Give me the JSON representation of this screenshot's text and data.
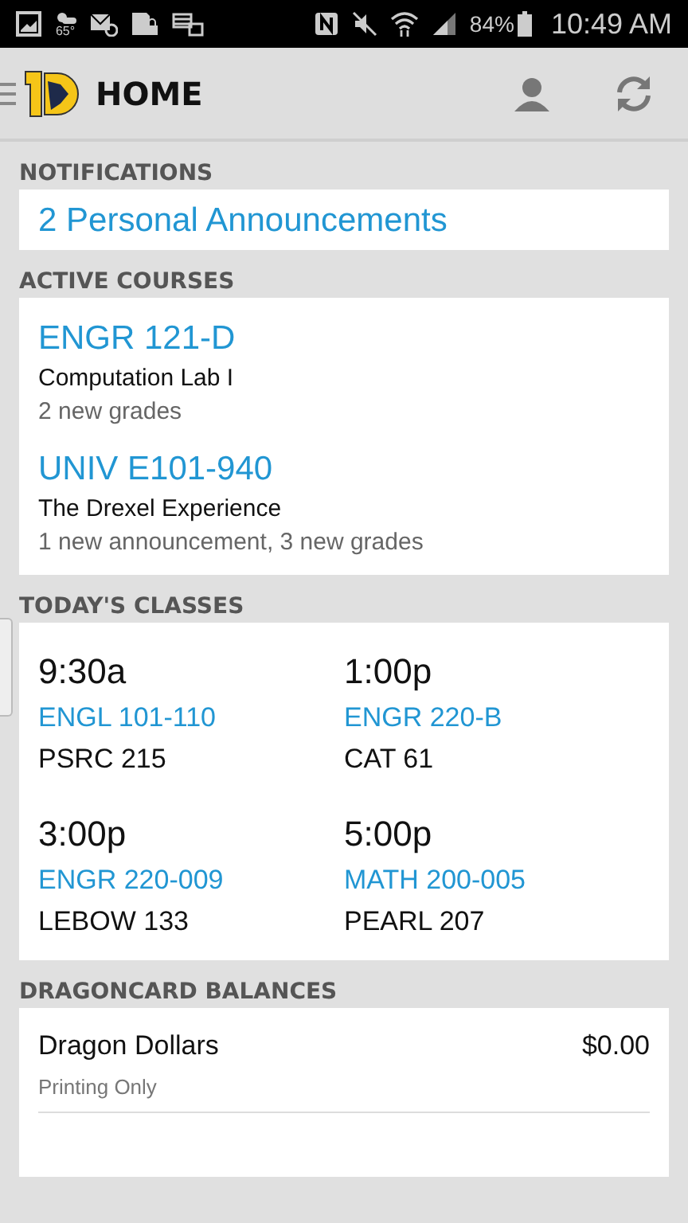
{
  "status_bar": {
    "temperature": "65°",
    "battery": "84%",
    "time": "10:49 AM"
  },
  "header": {
    "title": "HOME"
  },
  "notifications": {
    "heading": "NOTIFICATIONS",
    "link": "2 Personal Announcements"
  },
  "active_courses": {
    "heading": "ACTIVE COURSES",
    "items": [
      {
        "code": "ENGR 121-D",
        "name": "Computation Lab I",
        "summary": "2 new grades"
      },
      {
        "code": "UNIV E101-940",
        "name": "The Drexel Experience",
        "summary": "1 new announcement, 3 new grades"
      }
    ]
  },
  "todays_classes": {
    "heading": "TODAY'S CLASSES",
    "items": [
      {
        "time": "9:30a",
        "course": "ENGL 101-110",
        "room": "PSRC 215"
      },
      {
        "time": "1:00p",
        "course": "ENGR 220-B",
        "room": "CAT 61"
      },
      {
        "time": "3:00p",
        "course": "ENGR 220-009",
        "room": "LEBOW 133"
      },
      {
        "time": "5:00p",
        "course": "MATH 200-005",
        "room": "PEARL 207"
      }
    ]
  },
  "dragoncard_balances": {
    "heading": "DRAGONCARD BALANCES",
    "items": [
      {
        "name": "Dragon Dollars",
        "amount": "$0.00",
        "note": "Printing Only"
      }
    ]
  }
}
